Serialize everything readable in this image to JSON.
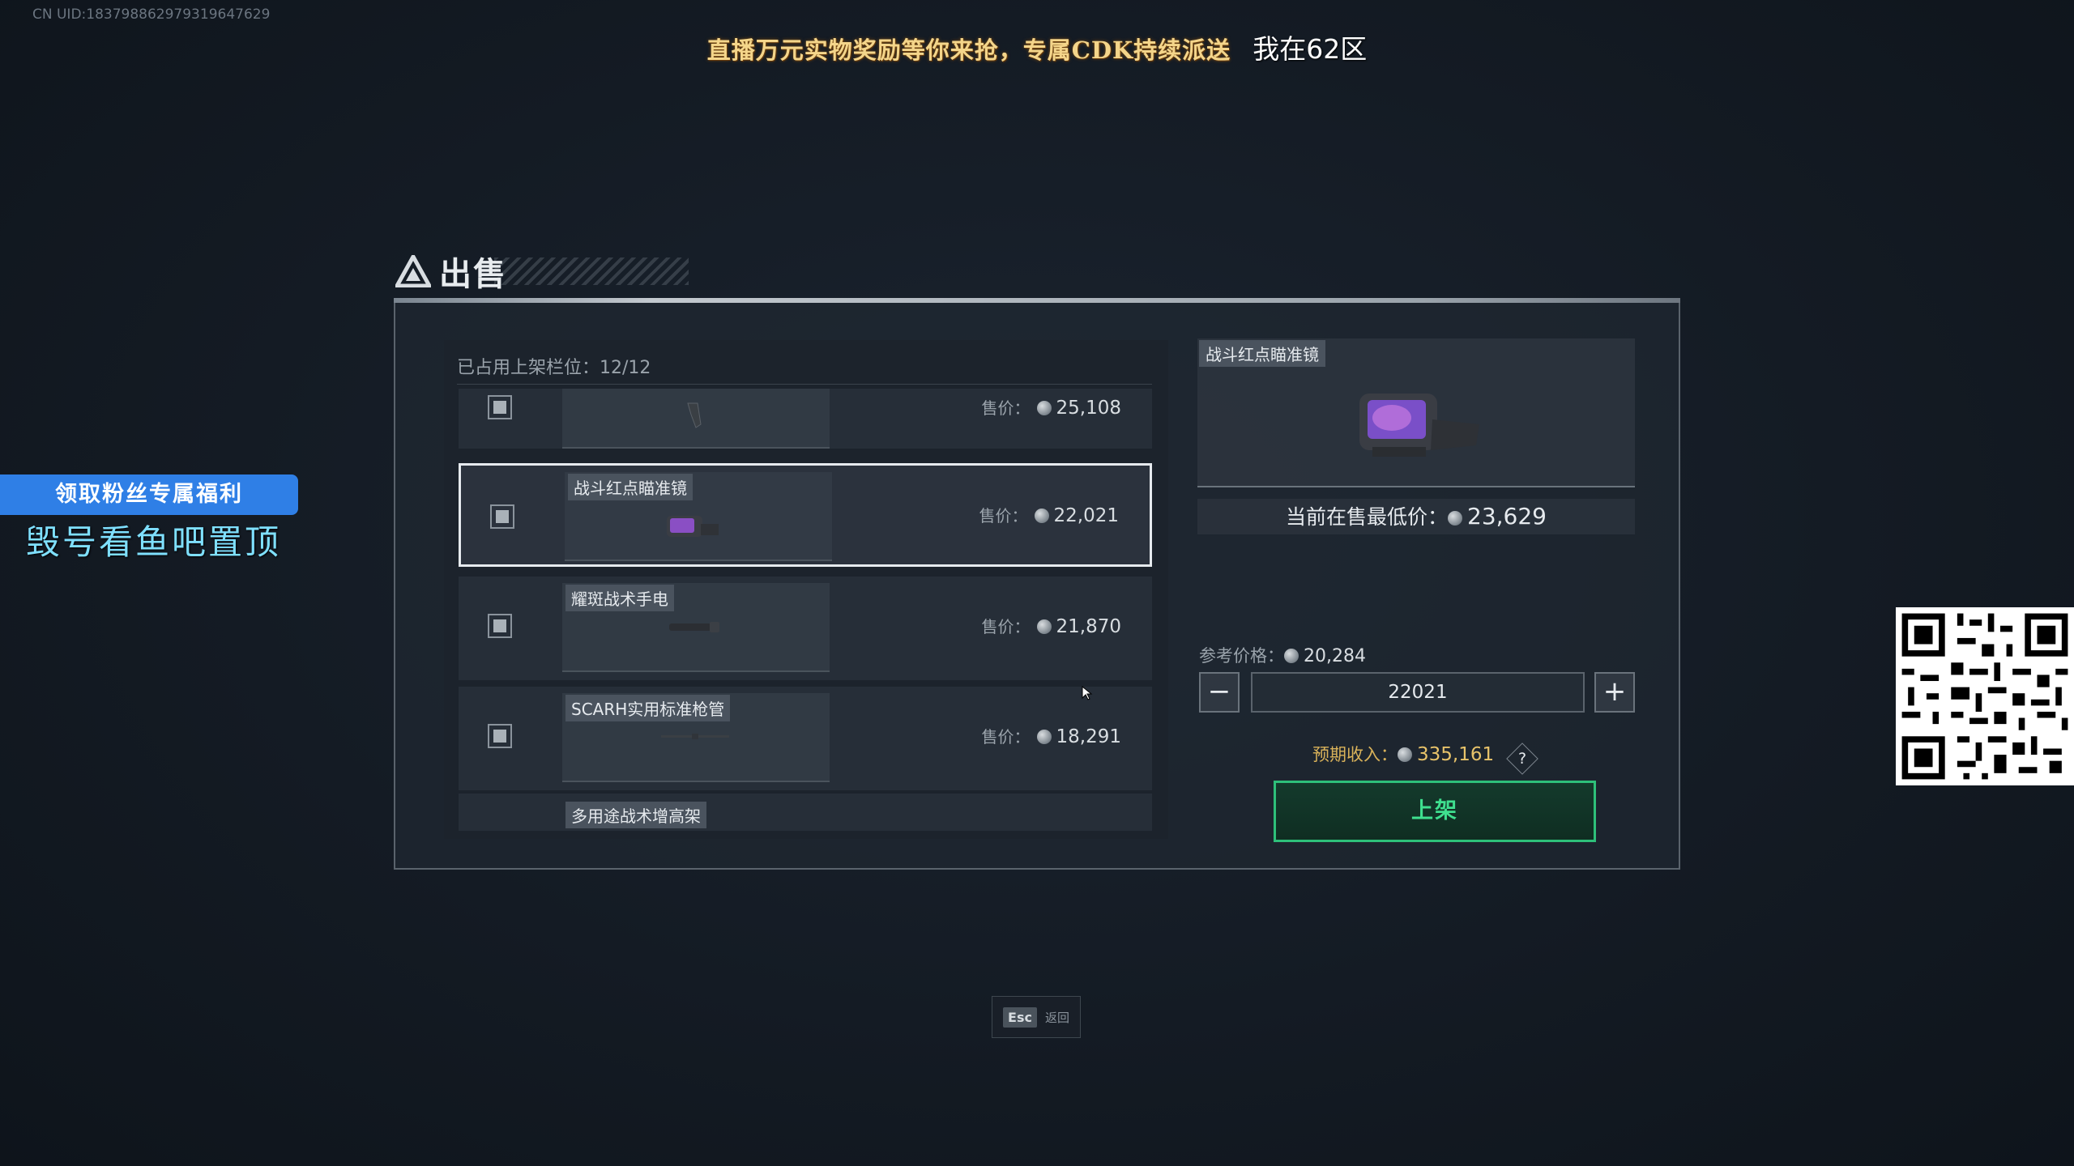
{
  "uid": "CN UID:183798862979319647629",
  "banner": {
    "promo": "直播万元实物奖励等你来抢，专属CDK持续派送",
    "region": "我在62区"
  },
  "side_promo": {
    "button": "领取粉丝专属福利",
    "text": "毁号看鱼吧置顶"
  },
  "page_title": "出售",
  "slots_label": "已占用上架栏位：12/12",
  "items": [
    {
      "name": "",
      "price_label": "售价：",
      "price": "25,108"
    },
    {
      "name": "战斗红点瞄准镜",
      "price_label": "售价：",
      "price": "22,021"
    },
    {
      "name": "耀斑战术手电",
      "price_label": "售价：",
      "price": "21,870"
    },
    {
      "name": "SCARH实用标准枪管",
      "price_label": "售价：",
      "price": "18,291"
    },
    {
      "name": "多用途战术增高架"
    }
  ],
  "detail": {
    "name": "战斗红点瞄准镜",
    "lowest_label": "当前在售最低价：",
    "lowest_value": "23,629",
    "ref_label": "参考价格：",
    "ref_value": "20,284",
    "minus": "−",
    "plus": "+",
    "price_input": "22021",
    "income_label": "预期收入：",
    "income_value": "335,161",
    "help": "?",
    "list_button": "上架"
  },
  "footer": {
    "esc_key": "Esc",
    "esc_label": "返回"
  },
  "colors": {
    "accent_green": "#2ec07a",
    "promo_blue": "#2f7fe6",
    "income_gold": "#d9b25a"
  }
}
